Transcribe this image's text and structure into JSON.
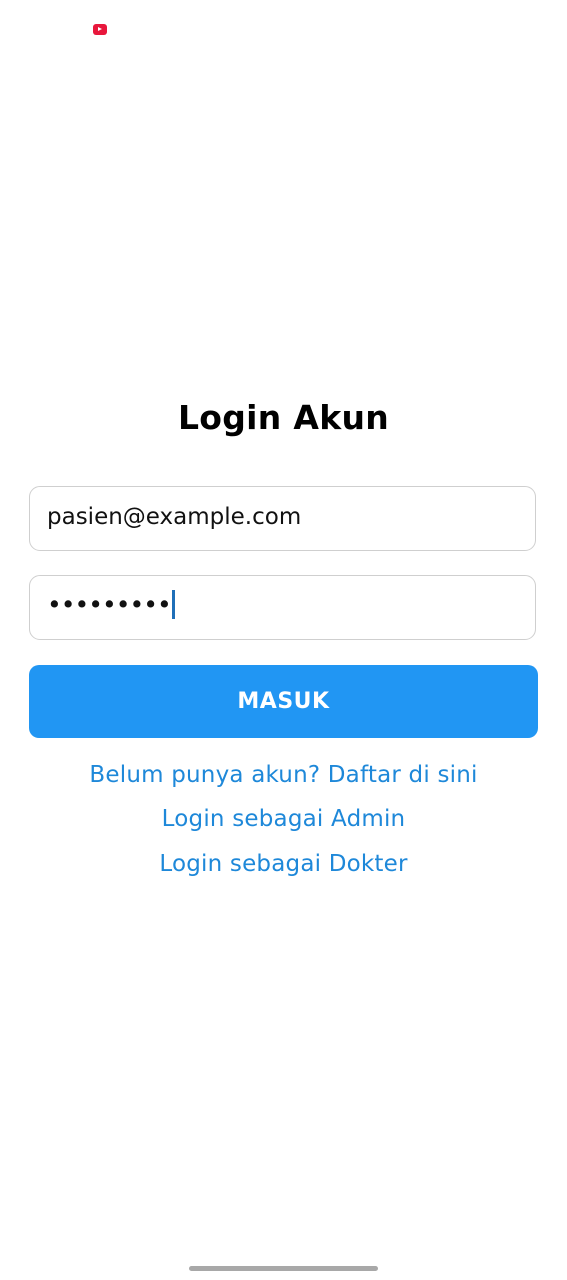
{
  "status_bar": {
    "notification_icon": "youtube-icon"
  },
  "login": {
    "title": "Login Akun",
    "email_value": "pasien@example.com",
    "password_masked": "•••••••••",
    "submit_label": "MASUK",
    "register_link": "Belum punya akun? Daftar di sini",
    "admin_link": "Login sebagai Admin",
    "doctor_link": "Login sebagai Dokter"
  },
  "colors": {
    "primary": "#2196f3",
    "link": "#1e88d9",
    "notification_icon": "#e8173c"
  }
}
